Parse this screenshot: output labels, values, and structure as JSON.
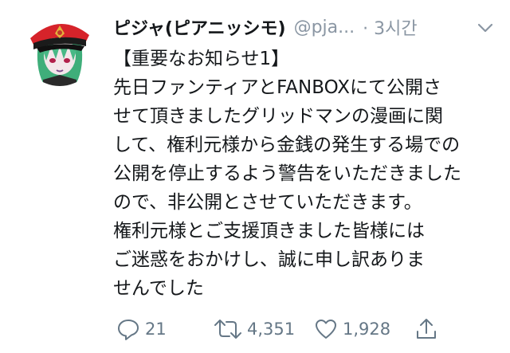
{
  "tweet": {
    "author_name": "ピジャ(ピアニッシモ)",
    "handle": "@pja...",
    "time": "· 3시간",
    "lines": [
      "【重要なお知らせ1】",
      "先日ファンティアとFANBOXにて公開さ",
      "せて頂きましたグリッドマンの漫画に関",
      "して、権利元様から金銭の発生する場での",
      "公開を停止するよう警告をいただきました",
      "ので、非公開とさせていただきます。",
      "権利元様とご支援頂きました皆様には",
      "ご迷惑をおかけし、誠に申し訳ありま",
      "せんでした"
    ]
  },
  "actions": {
    "reply_count": "21",
    "retweet_count": "4,351",
    "like_count": "1,928"
  },
  "icons": {
    "reply": "reply-icon",
    "retweet": "retweet-icon",
    "like": "heart-icon",
    "share": "share-icon",
    "menu": "chevron-down-icon"
  },
  "colors": {
    "text": "#14171a",
    "secondary": "#8a96a3",
    "action": "#657786"
  }
}
